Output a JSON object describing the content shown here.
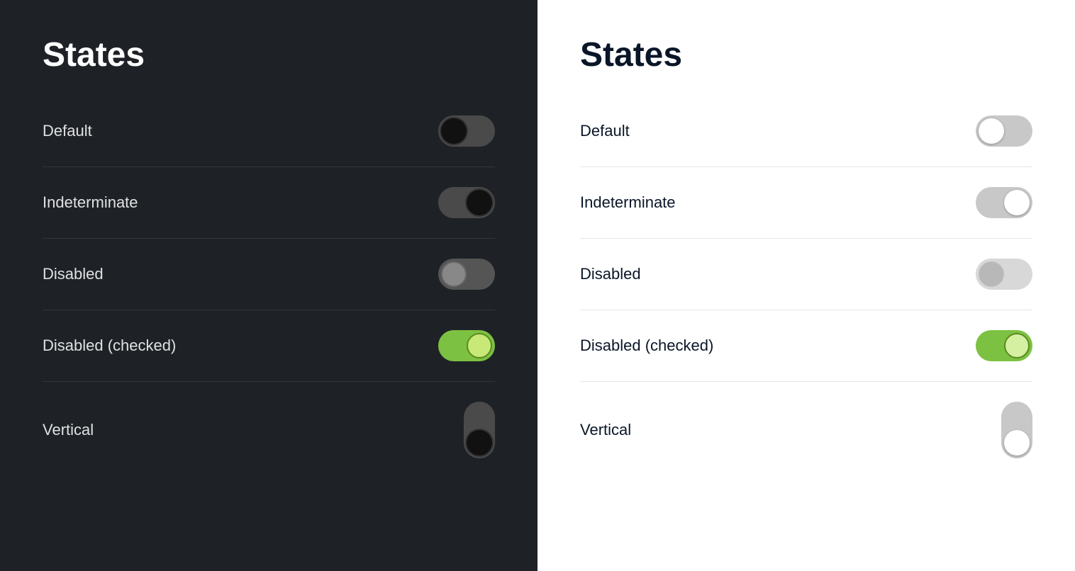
{
  "panels": [
    {
      "id": "dark",
      "theme": "dark",
      "title": "States",
      "states": [
        {
          "id": "default",
          "label": "Default"
        },
        {
          "id": "indeterminate",
          "label": "Indeterminate"
        },
        {
          "id": "disabled",
          "label": "Disabled"
        },
        {
          "id": "disabled-checked",
          "label": "Disabled (checked)"
        },
        {
          "id": "vertical",
          "label": "Vertical"
        }
      ]
    },
    {
      "id": "light",
      "theme": "light",
      "title": "States",
      "states": [
        {
          "id": "default",
          "label": "Default"
        },
        {
          "id": "indeterminate",
          "label": "Indeterminate"
        },
        {
          "id": "disabled",
          "label": "Disabled"
        },
        {
          "id": "disabled-checked",
          "label": "Disabled (checked)"
        },
        {
          "id": "vertical",
          "label": "Vertical"
        }
      ]
    }
  ]
}
